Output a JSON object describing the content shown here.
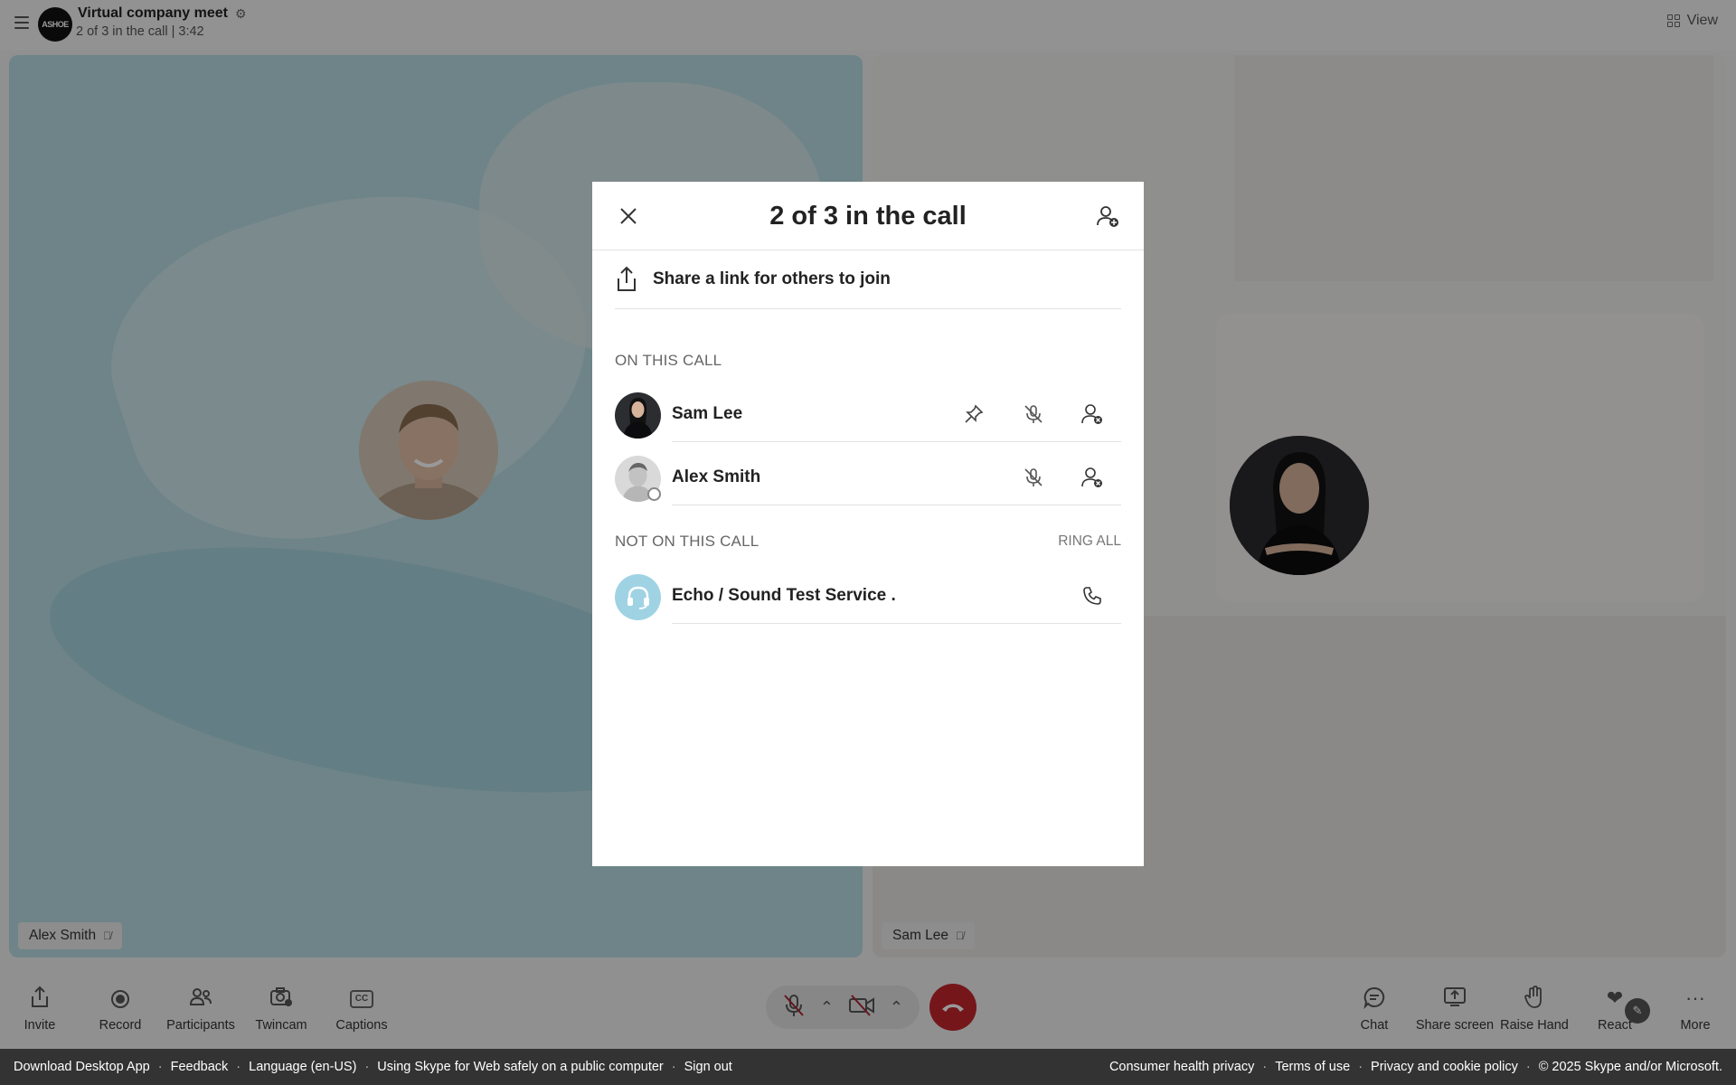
{
  "header": {
    "logo_text": "ASHOE",
    "title": "Virtual company meet",
    "subtitle": "2 of 3 in the call | 3:42",
    "view_label": "View"
  },
  "tiles": {
    "left_name": "Alex Smith",
    "right_name": "Sam Lee"
  },
  "modal": {
    "title": "2 of 3 in the call",
    "share_label": "Share a link for others to join",
    "on_call_heading": "ON THIS CALL",
    "not_on_call_heading": "NOT ON THIS CALL",
    "ring_all_label": "RING ALL",
    "on_call": [
      {
        "name": "Sam Lee"
      },
      {
        "name": "Alex Smith"
      }
    ],
    "not_on_call": [
      {
        "name": "Echo / Sound Test Service ."
      }
    ]
  },
  "controls": {
    "left": [
      {
        "label": "Invite",
        "icon": "share-up-icon"
      },
      {
        "label": "Record",
        "icon": "record-icon"
      },
      {
        "label": "Participants",
        "icon": "people-icon"
      },
      {
        "label": "Twincam",
        "icon": "camera-plus-icon"
      },
      {
        "label": "Captions",
        "icon": "captions-icon",
        "icon_text": "CC"
      }
    ],
    "right": [
      {
        "label": "Chat",
        "icon": "chat-bubble-icon"
      },
      {
        "label": "Share screen",
        "icon": "share-screen-icon"
      },
      {
        "label": "Raise Hand",
        "icon": "hand-icon"
      },
      {
        "label": "React",
        "icon": "heart-icon"
      },
      {
        "label": "More",
        "icon": "more-dots-icon"
      }
    ]
  },
  "footer": {
    "left": [
      "Download Desktop App",
      "Feedback",
      "Language (en-US)",
      "Using Skype for Web safely on a public computer",
      "Sign out"
    ],
    "right": [
      "Consumer health privacy",
      "Terms of use",
      "Privacy and cookie policy"
    ],
    "copyright": "© 2025 Skype and/or Microsoft."
  },
  "colors": {
    "hangup": "#c4262e",
    "react_heart": "#c0272d",
    "footer_bg": "#333333",
    "echo_avatar": "#9fd3e4"
  }
}
